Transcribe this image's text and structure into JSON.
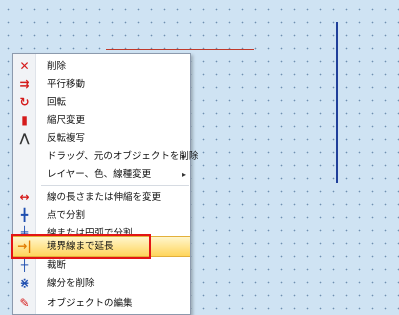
{
  "menu": {
    "items": [
      {
        "label": "削除",
        "icon": "delete-x-icon"
      },
      {
        "label": "平行移動",
        "icon": "move-icon"
      },
      {
        "label": "回転",
        "icon": "rotate-icon"
      },
      {
        "label": "縮尺変更",
        "icon": "scale-icon"
      },
      {
        "label": "反転複写",
        "icon": "mirror-copy-icon"
      },
      {
        "label": "ドラッグ、元のオブジェクトを削除",
        "icon": "",
        "submenu": true
      },
      {
        "label": "レイヤー、色、線種変更",
        "icon": "",
        "submenu": true
      },
      {
        "label": "線の長さまたは伸縮を変更",
        "icon": "line-length-icon"
      },
      {
        "label": "点で分割",
        "icon": "split-point-icon"
      },
      {
        "label": "線または円弧で分割",
        "icon": "split-by-line-icon"
      },
      {
        "label": "境界線まで延長",
        "icon": "extend-to-boundary-icon"
      },
      {
        "label": "裁断",
        "icon": "trim-icon"
      },
      {
        "label": "線分を削除",
        "icon": "delete-segment-icon"
      },
      {
        "label": "オブジェクトの編集",
        "icon": "edit-object-icon"
      }
    ],
    "submenu_arrow": "▸"
  },
  "colors": {
    "highlight_border": "#e31515",
    "canvas_bg": "#cfe3f3",
    "line_red": "#c0392b",
    "line_blue": "#1f3f9a"
  }
}
